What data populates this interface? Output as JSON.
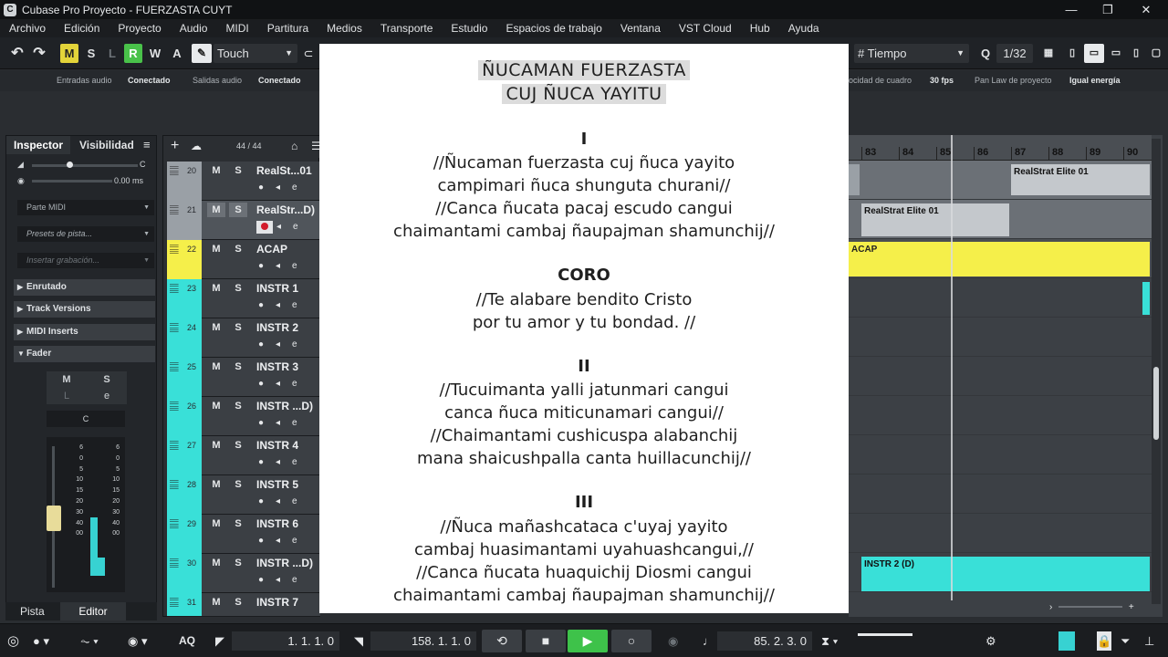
{
  "window": {
    "title": "Cubase Pro Proyecto - FUERZASTA CUYT",
    "minimize": "—",
    "maximize": "❐",
    "close": "✕"
  },
  "menu": [
    "Archivo",
    "Edición",
    "Proyecto",
    "Audio",
    "MIDI",
    "Partitura",
    "Medios",
    "Transporte",
    "Estudio",
    "Espacios de trabajo",
    "Ventana",
    "VST Cloud",
    "Hub",
    "Ayuda"
  ],
  "toolbar": {
    "undo": "↶",
    "redo": "↷",
    "m": "M",
    "s": "S",
    "l": "L",
    "r": "R",
    "w": "W",
    "a": "A",
    "automation_mode": "Touch",
    "grid_mode": "Tiempo",
    "quantize": "1/32"
  },
  "statusbar": {
    "audio_in_label": "Entradas audio",
    "audio_in_value": "Conectado",
    "audio_out_label": "Salidas audio",
    "audio_out_value": "Conectado",
    "fps_label": "ocidad de cuadro",
    "fps_value": "30 fps",
    "panlaw_label": "Pan Law de proyecto",
    "panlaw_value": "Igual energía"
  },
  "inspector": {
    "tab_inspector": "Inspector",
    "tab_visibility": "Visibilidad",
    "delay_value": "0.00 ms",
    "pan_value": "C",
    "midi_input": "Parte MIDI",
    "presets": "Presets de pista...",
    "insert_recording": "Insertar grabación...",
    "sections": [
      "Enrutado",
      "Track Versions",
      "MIDI Inserts",
      "Fader"
    ],
    "fader_m": "M",
    "fader_s": "S",
    "fader_l": "L",
    "fader_e": "e",
    "fader_pan": "C",
    "scale": [
      "6",
      "0",
      "5",
      "10",
      "15",
      "20",
      "30",
      "40",
      "00"
    ],
    "scale_right": [
      "6",
      "0",
      "5",
      "10",
      "15",
      "20",
      "30",
      "40",
      "00"
    ]
  },
  "bottomtabs": {
    "pista": "Pista",
    "editor": "Editor"
  },
  "tracklist_header": {
    "count": "44 / 44"
  },
  "tracks": [
    {
      "num": "20",
      "name": "RealSt...01",
      "color": "#9aa0a6"
    },
    {
      "num": "21",
      "name": "RealStr...D)",
      "color": "#9aa0a6"
    },
    {
      "num": "22",
      "name": "ACAP",
      "color": "#f5ef4a"
    },
    {
      "num": "23",
      "name": "INSTR 1",
      "color": "#39e0d8"
    },
    {
      "num": "24",
      "name": "INSTR 2",
      "color": "#39e0d8"
    },
    {
      "num": "25",
      "name": "INSTR 3",
      "color": "#39e0d8"
    },
    {
      "num": "26",
      "name": "INSTR ...D)",
      "color": "#39e0d8"
    },
    {
      "num": "27",
      "name": "INSTR 4",
      "color": "#39e0d8"
    },
    {
      "num": "28",
      "name": "INSTR 5",
      "color": "#39e0d8"
    },
    {
      "num": "29",
      "name": "INSTR 6",
      "color": "#39e0d8"
    },
    {
      "num": "30",
      "name": "INSTR ...D)",
      "color": "#39e0d8"
    },
    {
      "num": "31",
      "name": "INSTR 7",
      "color": "#39e0d8"
    }
  ],
  "ruler": [
    "83",
    "84",
    "85",
    "86",
    "87",
    "88",
    "89",
    "90"
  ],
  "events": {
    "e1": "RealStrat Elite 01",
    "e2": "RealStrat Elite 01",
    "e3": "ACAP",
    "e4": "INSTR 2 (D)"
  },
  "lyrics": {
    "title1": "ÑUCAMAN FUERZASTA",
    "title2": "CUJ ÑUCA YAYITU",
    "v1_head": "I",
    "v1": [
      "//Ñucaman fuerzasta cuj ñuca yayito",
      "campimari ñuca shunguta churani//",
      "//Canca ñucata pacaj escudo cangui",
      "chaimantami cambaj ñaupajman shamunchij//"
    ],
    "coro_head": "CORO",
    "coro": [
      "//Te alabare bendito Cristo",
      "por tu amor y tu bondad. //"
    ],
    "v2_head": "II",
    "v2": [
      "//Tucuimanta yalli jatunmari cangui",
      "canca ñuca miticunamari cangui//",
      "//Chaimantami cushicuspa alabanchij",
      "mana shaicushpalla canta huillacunchij//"
    ],
    "v3_head": "III",
    "v3": [
      "//Ñuca mañashcataca c'uyaj yayito",
      "cambaj huasimantami uyahuashcangui,//",
      "//Canca ñucata huaquichij Diosmi cangui",
      "chaimantami cambaj ñaupajman shamunchij//"
    ]
  },
  "transport": {
    "aq": "AQ",
    "left_locator": "1. 1. 1. 0",
    "right_locator": "158. 1. 1. 0",
    "position": "85. 2. 3. 0"
  }
}
